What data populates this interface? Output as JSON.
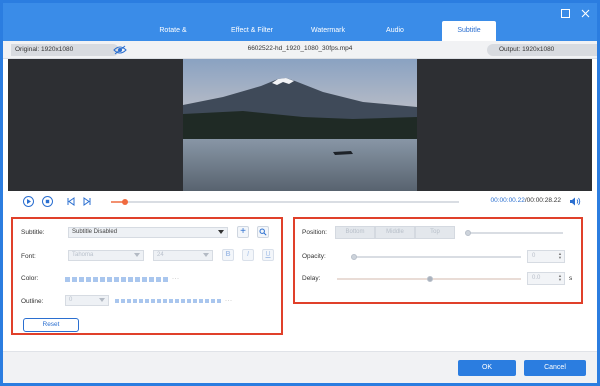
{
  "tabs": [
    {
      "label": "Rotate & Crop",
      "active": false
    },
    {
      "label": "Effect & Filter",
      "active": false
    },
    {
      "label": "Watermark",
      "active": false
    },
    {
      "label": "Audio",
      "active": false
    },
    {
      "label": "Subtitle",
      "active": true
    }
  ],
  "window_controls": {
    "maximize_icon": "square-icon",
    "close_icon": "close-icon"
  },
  "info": {
    "original": "Original: 1920x1080",
    "filename": "6602522-hd_1920_1080_30fps.mp4",
    "output": "Output: 1920x1080"
  },
  "player": {
    "current_time": "00:00:00.22",
    "separator": "/",
    "total_time": "00:00:28.22",
    "progress_fraction": 0.01
  },
  "subtitle_panel": {
    "subtitle_label": "Subtitle:",
    "subtitle_value": "Subtitle Disabled",
    "font_label": "Font:",
    "font_value": "Tahoma",
    "font_size_value": "24",
    "bold_label": "B",
    "italic_label": "I",
    "underline_label": "U",
    "color_label": "Color:",
    "outline_label": "Outline:",
    "outline_value": "0",
    "reset_label": "Reset"
  },
  "position_panel": {
    "position_label": "Position:",
    "position_options": [
      "Bottom",
      "Middle",
      "Top"
    ],
    "opacity_label": "Opacity:",
    "opacity_value": "0",
    "delay_label": "Delay:",
    "delay_value": "0.0",
    "delay_unit": "s"
  },
  "footer": {
    "ok_label": "OK",
    "cancel_label": "Cancel"
  },
  "colors": {
    "accent": "#2b7de0",
    "highlight_box": "#e0402a",
    "progress": "#f06a3f"
  }
}
